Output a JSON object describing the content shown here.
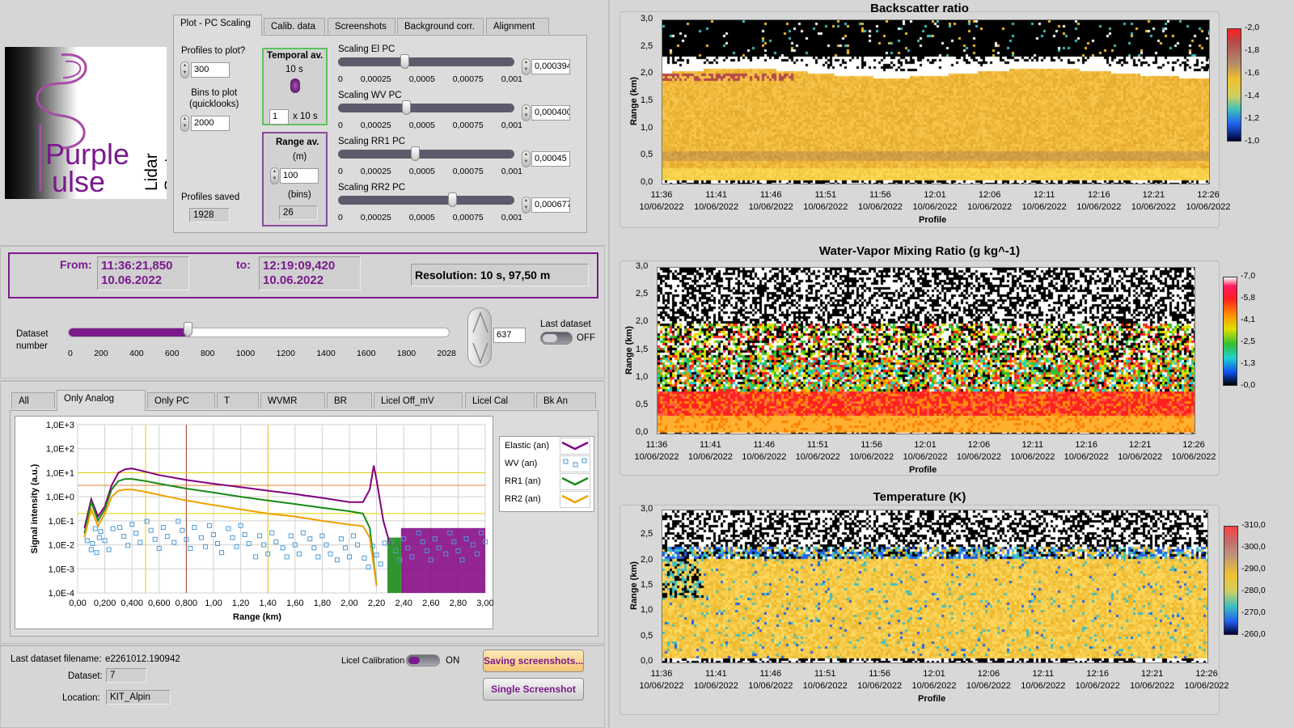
{
  "logo": {
    "word1": "Purple",
    "word2": "ulse",
    "company": "Lidar Systems S.L."
  },
  "top_tabs": [
    "Plot - PC Scaling",
    "Calib. data",
    "Screenshots",
    "Background corr.",
    "Alignment"
  ],
  "controls": {
    "profiles_to_plot_label": "Profiles to plot?",
    "profiles_to_plot": "300",
    "bins_to_plot_label": "Bins to plot\n(quicklooks)",
    "bins_to_plot": "2000",
    "profiles_saved_label": "Profiles saved",
    "profiles_saved": "1928",
    "temporal_av_label": "Temporal av.",
    "temporal_av_value": "10 s",
    "temporal_multiplier": "1",
    "temporal_unit": "x 10 s",
    "range_av_label": "Range av.",
    "range_av_m_unit": "(m)",
    "range_av_m": "100",
    "range_av_bins_unit": "(bins)",
    "range_av_bins": "26"
  },
  "scalings": [
    {
      "label": "Scaling El PC",
      "value": "0,000394",
      "level": 0.00039
    },
    {
      "label": "Scaling WV PC",
      "value": "0,000400",
      "level": 0.0004
    },
    {
      "label": "Scaling RR1 PC",
      "value": "0,00045",
      "level": 0.00045
    },
    {
      "label": "Scaling RR2 PC",
      "value": "0,000677",
      "level": 0.00067
    }
  ],
  "scaling_ticks": [
    "0",
    "0,00025",
    "0,0005",
    "0,00075",
    "0,001"
  ],
  "time_range": {
    "from_label": "From:",
    "from_time": "11:36:21,850",
    "from_date": "10.06.2022",
    "to_label": "to:",
    "to_time": "12:19:09,420",
    "to_date": "10.06.2022",
    "resolution": "Resolution: 10 s, 97,50 m"
  },
  "dataset": {
    "label": "Dataset\nnumber",
    "value": "637",
    "level": 637,
    "max": 2028,
    "ticks": [
      "0",
      "200",
      "400",
      "600",
      "800",
      "1000",
      "1200",
      "1400",
      "1600",
      "1800",
      "2028"
    ],
    "last_dataset_label": "Last dataset",
    "last_dataset_state": "OFF"
  },
  "plot_tabs": [
    "All",
    "Only Analog",
    "Only PC",
    "T",
    "WVMR",
    "BR",
    "Licel Off_mV",
    "Licel Cal",
    "Bk An"
  ],
  "chart_data": [
    {
      "type": "line",
      "xlabel": "Range (km)",
      "ylabel": "Signal intensity (a.u.)",
      "x_ticks": [
        "0,00",
        "0,200",
        "0,400",
        "0,600",
        "0,800",
        "1,00",
        "1,20",
        "1,40",
        "1,60",
        "1,80",
        "2,00",
        "2,20",
        "2,40",
        "2,60",
        "2,80",
        "3,00"
      ],
      "y_ticks": [
        "1,0E+3",
        "1,0E+2",
        "1,0E+1",
        "1,0E+0",
        "1,0E-1",
        "1,0E-2",
        "1,0E-3",
        "1,0E-4"
      ],
      "xlim": [
        0,
        3.0
      ],
      "ylim": [
        0.0001,
        1000
      ],
      "yscale": "log",
      "legend": "right",
      "series": [
        {
          "name": "Elastic (an)",
          "color": "#800080",
          "x": [
            0.05,
            0.1,
            0.15,
            0.2,
            0.25,
            0.3,
            0.35,
            0.4,
            0.5,
            0.6,
            0.8,
            1.0,
            1.2,
            1.4,
            1.6,
            1.8,
            2.0,
            2.1,
            2.15,
            2.18,
            2.2,
            2.25,
            2.3
          ],
          "y": [
            0.05,
            0.8,
            0.15,
            0.4,
            3,
            10,
            14,
            15,
            11,
            8,
            5,
            3.5,
            2.5,
            1.8,
            1.3,
            0.9,
            0.6,
            0.6,
            2,
            20,
            5,
            0.1,
            0.01
          ]
        },
        {
          "name": "WV (an)",
          "color": "#4a9ad8",
          "marker": "square",
          "x": [
            0.1,
            0.2,
            0.4,
            0.6,
            0.8,
            1.0,
            1.2,
            1.4,
            1.6,
            1.8,
            2.0,
            2.2,
            2.4,
            2.6,
            2.8,
            3.0
          ],
          "y": [
            0.02,
            0.02,
            0.04,
            0.03,
            0.03,
            0.02,
            0.02,
            0.01,
            0.01,
            0.01,
            0.01,
            0.005,
            0.01,
            0.01,
            0.01,
            0.01
          ]
        },
        {
          "name": "RR1 (an)",
          "color": "#1a8a1a",
          "x": [
            0.05,
            0.1,
            0.15,
            0.2,
            0.25,
            0.3,
            0.35,
            0.4,
            0.5,
            0.6,
            0.8,
            1.0,
            1.2,
            1.4,
            1.6,
            1.8,
            2.0,
            2.1,
            2.15,
            2.2
          ],
          "y": [
            0.03,
            0.6,
            0.1,
            0.3,
            2,
            4.5,
            5.5,
            5.5,
            4.5,
            3.5,
            2.2,
            1.5,
            1.0,
            0.7,
            0.5,
            0.35,
            0.25,
            0.2,
            0.05,
            0.0002
          ]
        },
        {
          "name": "RR2 (an)",
          "color": "#f0a000",
          "x": [
            0.05,
            0.1,
            0.15,
            0.2,
            0.25,
            0.3,
            0.35,
            0.4,
            0.5,
            0.6,
            0.8,
            1.0,
            1.2,
            1.4,
            1.6,
            1.8,
            2.0,
            2.1,
            2.15,
            2.2
          ],
          "y": [
            0.02,
            0.3,
            0.06,
            0.2,
            1,
            1.8,
            2.0,
            2.0,
            1.6,
            1.2,
            0.7,
            0.45,
            0.3,
            0.2,
            0.15,
            0.1,
            0.07,
            0.06,
            0.02,
            0.0002
          ]
        }
      ]
    },
    {
      "type": "heatmap",
      "title": "Backscatter ratio",
      "xlabel": "Profile",
      "ylabel": "Range (km)",
      "y_ticks": [
        "3,0",
        "2,5",
        "2,0",
        "1,5",
        "1,0",
        "0,5",
        "0,0"
      ],
      "x_ticks": [
        "11:36",
        "11:41",
        "11:46",
        "11:51",
        "11:56",
        "12:01",
        "12:06",
        "12:11",
        "12:16",
        "12:21",
        "12:26"
      ],
      "x_date": "10/06/2022",
      "colorbar_ticks": [
        "2,0",
        "1,8",
        "1,6",
        "1,4",
        "1,2",
        "1,0"
      ]
    },
    {
      "type": "heatmap",
      "title": "Water-Vapor Mixing Ratio  (g kg^-1)",
      "xlabel": "Profile",
      "ylabel": "Range (km)",
      "y_ticks": [
        "3,0",
        "2,5",
        "2,0",
        "1,5",
        "1,0",
        "0,5",
        "0,0"
      ],
      "x_ticks": [
        "11:36",
        "11:41",
        "11:46",
        "11:51",
        "11:56",
        "12:01",
        "12:06",
        "12:11",
        "12:16",
        "12:21",
        "12:26"
      ],
      "x_date": "10/06/2022",
      "colorbar_ticks": [
        "7,0",
        "5,8",
        "4,1",
        "2,5",
        "1,3",
        "0,0"
      ]
    },
    {
      "type": "heatmap",
      "title": "Temperature (K)",
      "xlabel": "Profile",
      "ylabel": "Range (km)",
      "y_ticks": [
        "3,0",
        "2,5",
        "2,0",
        "1,5",
        "1,0",
        "0,5",
        "0,0"
      ],
      "x_ticks": [
        "11:36",
        "11:41",
        "11:46",
        "11:51",
        "11:56",
        "12:01",
        "12:06",
        "12:11",
        "12:16",
        "12:21",
        "12:26"
      ],
      "x_date": "10/06/2022",
      "colorbar_ticks": [
        "310,0",
        "300,0",
        "290,0",
        "280,0",
        "270,0",
        "260,0"
      ]
    }
  ],
  "footer": {
    "filename_label": "Last dataset filename:",
    "filename": "e2261012.190942",
    "dataset_label": "Dataset:",
    "dataset": "7",
    "location_label": "Location:",
    "location": "KIT_Alpin",
    "licel_cal_label": "Licel Calibration",
    "licel_cal_state": "ON",
    "saving_button": "Saving screenshots...",
    "single_button": "Single Screenshot"
  },
  "colors": {
    "accent": "#7a1a8c",
    "elastic": "#800080",
    "wv": "#4a9ad8",
    "rr1": "#1a8a1a",
    "rr2": "#f0a000"
  }
}
